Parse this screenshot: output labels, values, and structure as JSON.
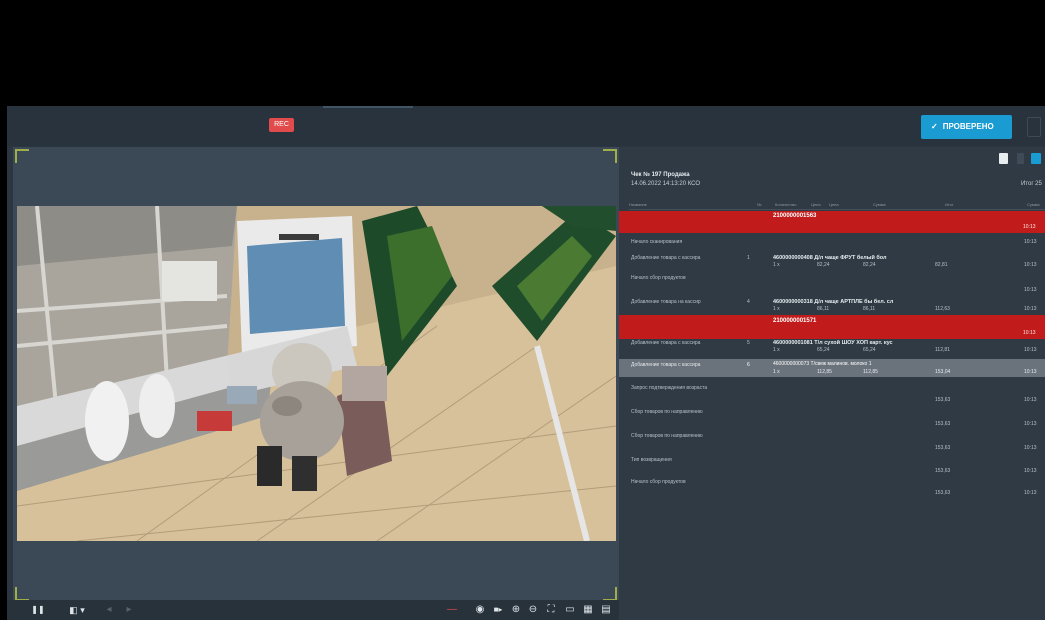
{
  "toolbar": {
    "rec_badge": "REC",
    "verify_label": "ПРОВЕРЕНО",
    "verify_check": "✓"
  },
  "controls": {
    "pause": "❚❚",
    "camera": "◧ ▾",
    "prev": "◂",
    "next": "▸",
    "timeline_marker": "—",
    "snapshot": "◉",
    "video": "■▸",
    "zoom_in": "⊕",
    "zoom_out": "⊖",
    "fullscreen": "⛶",
    "screen": "▭",
    "grid": "▦",
    "chat": "▤"
  },
  "receipt": {
    "title": "Чек № 197 Продажа",
    "subtitle": "14.06.2022 14:13:20 КСО",
    "right_label": "Итог 25",
    "columns": [
      "Название",
      "№",
      "Количество",
      "Цена",
      "Цена",
      "Сумма",
      "Итог",
      "Сумма"
    ],
    "bands": [
      {
        "text": "2100000001563"
      },
      {
        "text": "2100000001571"
      }
    ],
    "rows": [
      {
        "label": "Начало сканирования",
        "code": "",
        "sum": "",
        "total": "10:13"
      },
      {
        "label": "Добавление товара с кассира",
        "num": "1",
        "code": "4600000000408 Д/л чаще ФРУТ белый бол",
        "qty": "1 х",
        "price": "82,24",
        "total_price": "82,24",
        "sum": "82,81",
        "total": "10:13"
      },
      {
        "label": "Начало сбор продуктов",
        "code": "",
        "sum": "",
        "total": "10:13"
      },
      {
        "label": "Добавление товара на кассир",
        "num": "4",
        "code": "4600000000318 Д/л чаще АРТПЛЕ бы бел. сл",
        "qty": "1 х",
        "price": "86,11",
        "total_price": "86,11",
        "sum": "112,63",
        "total": "10:13"
      },
      {
        "label": "Добавление товара с кассира",
        "num": "5",
        "code": "4600000001081 Т/л сухой ШОУ ХОП карт. кус",
        "qty": "1 х",
        "price": "65,24",
        "total_price": "65,24",
        "sum": "112,81",
        "total": "10:13"
      },
      {
        "label": "Добавление товара с кассира",
        "num": "6",
        "code": "4600000000073 Т/свеж малинов. молоко 1",
        "qty": "1 х",
        "price": "112,85",
        "total_price": "112,85",
        "sum": "153,04",
        "total": "10:13"
      },
      {
        "label": "Запрос подтверждения возраста",
        "code": "",
        "sum": "153,63",
        "total": "10:13"
      },
      {
        "label": "Сбор товаров по направлению",
        "code": "",
        "sum": "153,63",
        "total": "10:13"
      },
      {
        "label": "Сбор товаров по направлению",
        "code": "",
        "sum": "153,63",
        "total": "10:13"
      },
      {
        "label": "Тип возвращения",
        "code": "",
        "sum": "153,63",
        "total": "10:13"
      },
      {
        "label": "Начало сбор продуктов",
        "code": "",
        "sum": "153,63",
        "total": "10:13"
      }
    ]
  }
}
